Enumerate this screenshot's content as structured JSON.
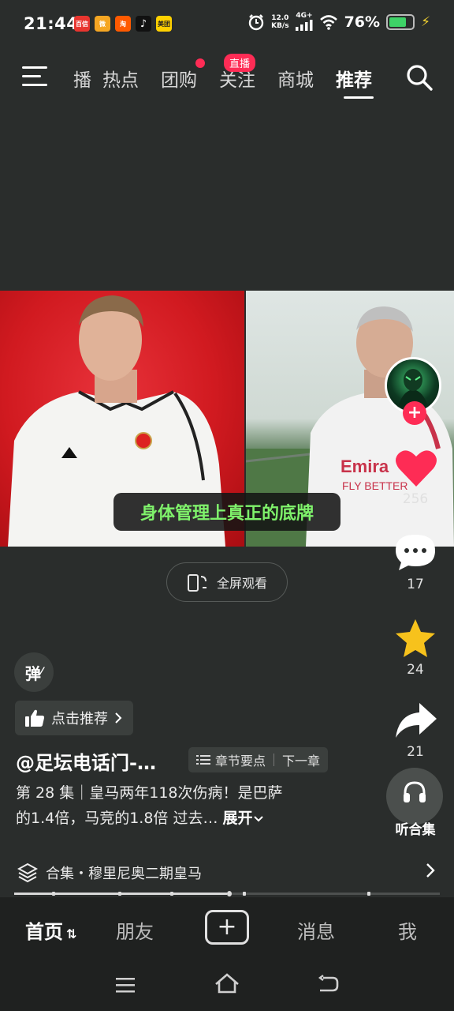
{
  "status_bar": {
    "time": "21:44",
    "notification_apps": [
      {
        "icon": "shopping-app-icon",
        "label": "百信",
        "color": "#e8352f"
      },
      {
        "icon": "weibo-icon",
        "label": "微",
        "color": "#f5a623"
      },
      {
        "icon": "taobao-icon",
        "label": "淘",
        "color": "#ff5a00"
      },
      {
        "icon": "tiktok-icon",
        "label": "♪",
        "color": "#111111"
      },
      {
        "icon": "meituan-icon",
        "label": "美团",
        "color": "#ffd100"
      }
    ],
    "net_speed_value": "12.0",
    "net_speed_unit": "KB/s",
    "network": "4G+",
    "battery_percent": "76%",
    "battery_level": 0.76
  },
  "top_nav": {
    "tabs": [
      {
        "label": "播",
        "partial": true
      },
      {
        "label": "热点"
      },
      {
        "label": "团购",
        "red_dot": true
      },
      {
        "label": "关注",
        "badge": "直播"
      },
      {
        "label": "商城"
      },
      {
        "label": "推荐",
        "active": true
      }
    ]
  },
  "video": {
    "subtitle": "身体管理上真正的底牌",
    "fullscreen_label": "全屏观看"
  },
  "sidebar": {
    "likes": "256",
    "comments": "17",
    "favorites": "24",
    "shares": "21",
    "listen_label": "听合集"
  },
  "info": {
    "danmu_label": "弹",
    "recommend_label": "点击推荐",
    "author": "@足坛电话门-…",
    "chapter_points": "章节要点",
    "next_chapter": "下一章",
    "description_line1": "第 28 集｜皇马两年118次伤病！是巴萨",
    "description_line2": "的1.4倍，马竞的1.8倍 过去…",
    "expand_label": "展开",
    "collection": "合集・穆里尼奥二期皇马",
    "progress": 0.5
  },
  "bottom_nav": {
    "home": "首页",
    "friends": "朋友",
    "messages": "消息",
    "me": "我"
  },
  "colors": {
    "accent_red": "#fe2c55",
    "subtitle_green": "#7ff26b",
    "favorite_yellow": "#f7c21c",
    "background": "#2a2d2c"
  }
}
